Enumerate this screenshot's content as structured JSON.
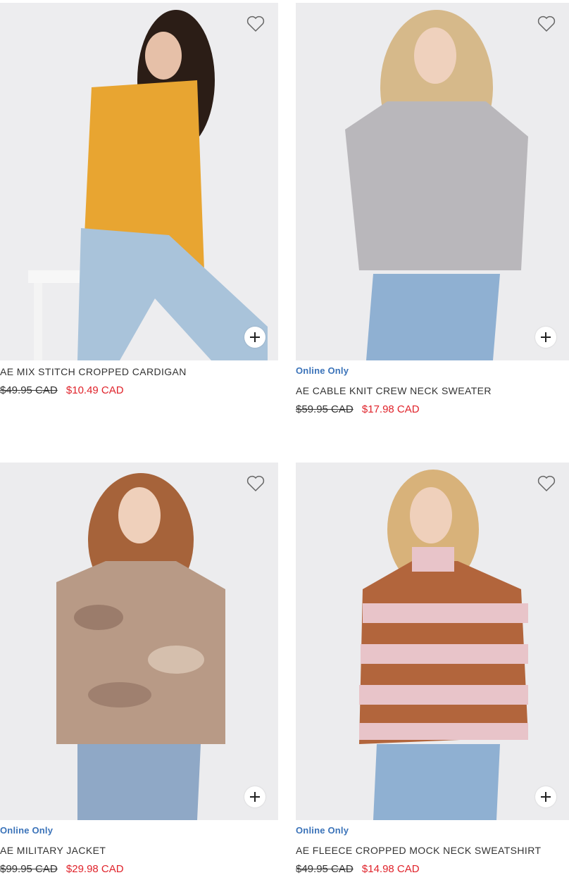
{
  "products": [
    {
      "name": "AE MIX STITCH CROPPED CARDIGAN",
      "flag": "",
      "original_price": "$49.95 CAD",
      "sale_price": "$10.49 CAD",
      "colors": {
        "top": "#e8a531",
        "bottom": "#a9c3da",
        "hair": "#2b1d16",
        "skin": "#e6c0a8"
      }
    },
    {
      "name": "AE CABLE KNIT CREW NECK SWEATER",
      "flag": "Online Only",
      "original_price": "$59.95 CAD",
      "sale_price": "$17.98 CAD",
      "colors": {
        "top": "#b9b7bb",
        "bottom": "#8fb0d2",
        "hair": "#d6b98a",
        "skin": "#efd1bd"
      }
    },
    {
      "name": "AE MILITARY JACKET",
      "flag": "Online Only",
      "original_price": "$99.95 CAD",
      "sale_price": "$29.98 CAD",
      "colors": {
        "top": "#b89a86",
        "bottom": "#8fa8c6",
        "hair": "#a6633a",
        "skin": "#efd0bb"
      }
    },
    {
      "name": "AE FLEECE CROPPED MOCK NECK SWEATSHIRT",
      "flag": "Online Only",
      "original_price": "$49.95 CAD",
      "sale_price": "$14.98 CAD",
      "colors": {
        "top": "#b2653c",
        "bottom": "#8fb0d2",
        "hair": "#d8b27a",
        "skin": "#efd0bb"
      }
    }
  ]
}
